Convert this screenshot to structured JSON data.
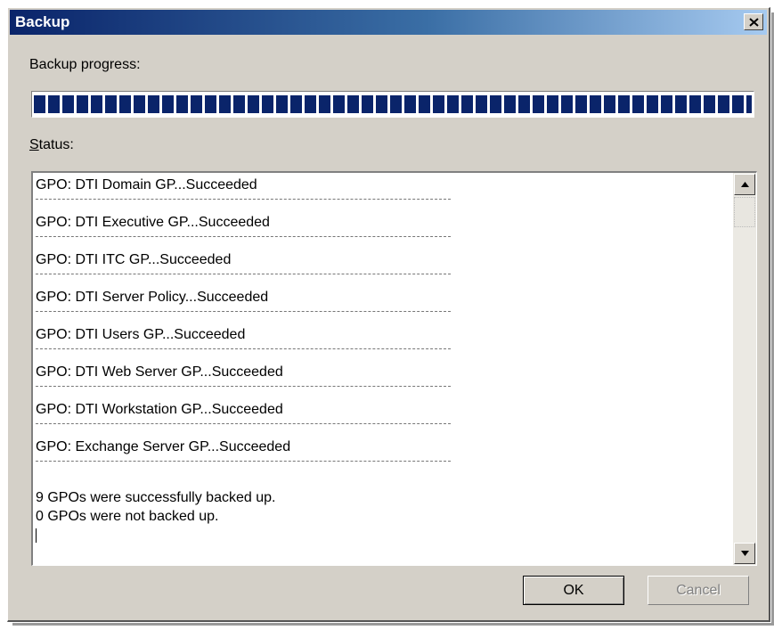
{
  "window": {
    "title": "Backup"
  },
  "progress": {
    "label": "Backup progress:",
    "fraction": 1.0
  },
  "status": {
    "label": "Status:",
    "entries": [
      "GPO: DTI Domain GP...Succeeded",
      "GPO: DTI Executive GP...Succeeded",
      "GPO: DTI ITC GP...Succeeded",
      "GPO: DTI Server Policy...Succeeded",
      "GPO: DTI Users GP...Succeeded",
      "GPO: DTI Web Server GP...Succeeded",
      "GPO: DTI Workstation GP...Succeeded",
      "GPO: Exchange Server GP...Succeeded"
    ],
    "summary_1": "9 GPOs were successfully backed up.",
    "summary_2": "0 GPOs were not backed up."
  },
  "buttons": {
    "ok_label": "OK",
    "cancel_label": "Cancel"
  },
  "icons": {
    "close": "close-icon",
    "scroll_up": "arrow-up-icon",
    "scroll_down": "arrow-down-icon"
  },
  "colors": {
    "progress_fill": "#0a246a",
    "titlebar": "#0a246a"
  }
}
